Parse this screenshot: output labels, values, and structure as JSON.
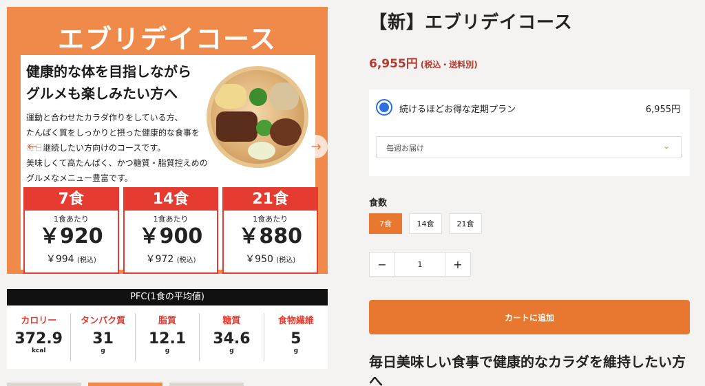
{
  "promo": {
    "title": "エブリデイコース",
    "headline_1": "健康的な体を目指しながら",
    "headline_2": "グルメも楽しみたい方へ",
    "desc_1": "運動と合わせたカラダ作りをしている方、",
    "desc_2": "たんぱく質をしっかりと摂った健康的な食事を",
    "desc_3": "毎日継続したい方向けのコースです。",
    "desc_4": "美味しくて高たんぱく、かつ糖質・脂質控えめの",
    "desc_5": "グルメなメニュー豊富です。",
    "prices": [
      {
        "label": "7食",
        "per": "1食あたり",
        "big": "￥920",
        "small": "￥994",
        "tax": "(税込)"
      },
      {
        "label": "14食",
        "per": "1食あたり",
        "big": "￥900",
        "small": "￥972",
        "tax": "(税込)"
      },
      {
        "label": "21食",
        "per": "1食あたり",
        "big": "￥880",
        "small": "￥950",
        "tax": "(税込)"
      }
    ]
  },
  "pfc": {
    "heading": "PFC(1食の平均値)",
    "items": [
      {
        "name": "カロリー",
        "value": "372.9",
        "unit": "kcal"
      },
      {
        "name": "タンパク質",
        "value": "31",
        "unit": "g"
      },
      {
        "name": "脂質",
        "value": "12.1",
        "unit": "g"
      },
      {
        "name": "糖質",
        "value": "34.6",
        "unit": "g"
      },
      {
        "name": "食物繊維",
        "value": "5",
        "unit": "g"
      }
    ]
  },
  "product": {
    "title": "【新】エブリデイコース",
    "price": "6,955円",
    "price_note": "(税込・送料別)"
  },
  "plan": {
    "name": "続けるほどお得な定期プラン",
    "price": "6,955円",
    "delivery": "毎週お届け"
  },
  "quantity": {
    "label": "食数",
    "options": [
      "7食",
      "14食",
      "21食"
    ],
    "selected": "7食",
    "count": "1",
    "minus": "−",
    "plus": "+"
  },
  "cart": {
    "label": "カートに追加"
  },
  "subhead": "毎日美味しい食事で健康的なカラダを維持したい方へ",
  "colors": {
    "accent": "#e8772f",
    "price": "#b33a2f",
    "red": "#e63b30",
    "radio": "#2b6fe0"
  },
  "icons": {
    "prev": "arrow-left-icon",
    "next": "arrow-right-icon",
    "chevron": "chevron-down-icon"
  }
}
